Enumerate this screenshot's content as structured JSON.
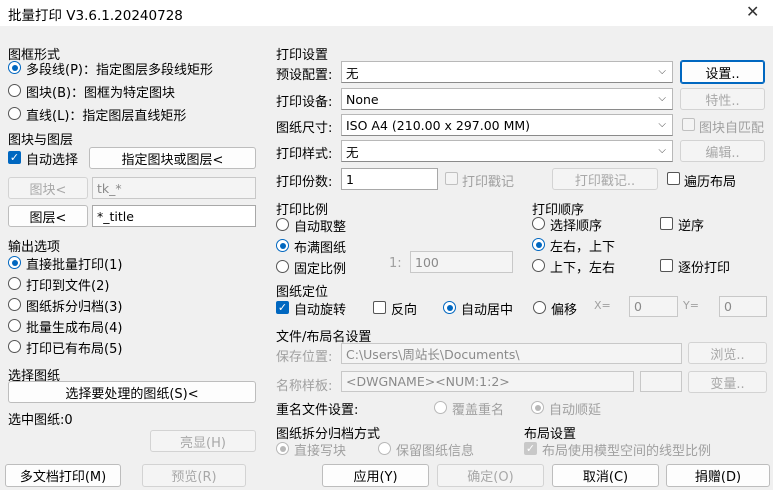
{
  "window": {
    "title": "批量打印 V3.6.1.20240728",
    "close": "✕"
  },
  "frame_type": {
    "title": "图框形式",
    "options": [
      {
        "label": "多段线(P)：指定图层多段线矩形",
        "checked": true
      },
      {
        "label": "图块(B)：图框为特定图块",
        "checked": false
      },
      {
        "label": "直线(L)：指定图层直线矩形",
        "checked": false
      }
    ]
  },
  "block_layer": {
    "title": "图块与图层",
    "auto_select": "自动选择",
    "specify_button": "指定图块或图层<",
    "block_button": "图块<",
    "block_value": "tk_*",
    "layer_button": "图层<",
    "layer_value": "*_title"
  },
  "output": {
    "title": "输出选项",
    "options": [
      {
        "label": "直接批量打印(1)",
        "checked": true
      },
      {
        "label": "打印到文件(2)",
        "checked": false
      },
      {
        "label": "图纸拆分归档(3)",
        "checked": false
      },
      {
        "label": "批量生成布局(4)",
        "checked": false
      },
      {
        "label": "打印已有布局(5)",
        "checked": false
      }
    ]
  },
  "select_drawings": {
    "title": "选择图纸",
    "button": "选择要处理的图纸(S)<",
    "selected_label": "选中图纸:0",
    "highlight_button": "亮显(H)"
  },
  "print_settings": {
    "title": "打印设置",
    "preset_label": "预设配置:",
    "preset_value": "无",
    "setup_button": "设置..",
    "device_label": "打印设备:",
    "device_value": "None",
    "props_button": "特性..",
    "paper_label": "图纸尺寸:",
    "paper_value": "ISO A4 (210.00 x 297.00 MM)",
    "auto_match": "图块自匹配",
    "style_label": "打印样式:",
    "style_value": "无",
    "edit_button": "编辑..",
    "copies_label": "打印份数:",
    "copies_value": "1",
    "stamp_check": "打印戳记",
    "stamp_button": "打印戳记..",
    "traverse_layouts": "遍历布局"
  },
  "scale": {
    "title": "打印比例",
    "options": [
      {
        "label": "自动取整",
        "checked": false
      },
      {
        "label": "布满图纸",
        "checked": true
      },
      {
        "label": "固定比例",
        "checked": false
      }
    ],
    "ratio_prefix": "1:",
    "ratio_value": "100"
  },
  "order": {
    "title": "打印顺序",
    "select_order": "选择顺序",
    "reverse": "逆序",
    "lr_tb": "左右，上下",
    "tb_lr": "上下，左右",
    "copy_by_copy": "逐份打印"
  },
  "position": {
    "title": "图纸定位",
    "auto_rotate": "自动旋转",
    "reverse": "反向",
    "auto_center": "自动居中",
    "offset": "偏移",
    "x_label": "X=",
    "x_value": "0",
    "y_label": "Y=",
    "y_value": "0"
  },
  "file_settings": {
    "title": "文件/布局名设置",
    "save_label": "保存位置:",
    "save_value": "C:\\Users\\周站长\\Documents\\",
    "browse_button": "浏览..",
    "pattern_label": "名称样板:",
    "pattern_value": "<DWGNAME><NUM:1:2>",
    "variable_button": "变量..",
    "rename_label": "重名文件设置:",
    "overwrite": "覆盖重名",
    "auto_increment": "自动顺延"
  },
  "split": {
    "title": "图纸拆分归档方式",
    "direct_write": "直接写块",
    "keep_info": "保留图纸信息"
  },
  "layout_settings": {
    "title": "布局设置",
    "use_model_linetype": "布局使用模型空间的线型比例"
  },
  "footer": {
    "multi_doc": "多文档打印(M)",
    "preview": "预览(R)",
    "apply": "应用(Y)",
    "ok": "确定(O)",
    "cancel": "取消(C)",
    "donate": "捐赠(D)"
  },
  "colors": {
    "accent": "#0067c0",
    "disabled_text": "#a0a0a0",
    "background": "#f0f0f0"
  }
}
